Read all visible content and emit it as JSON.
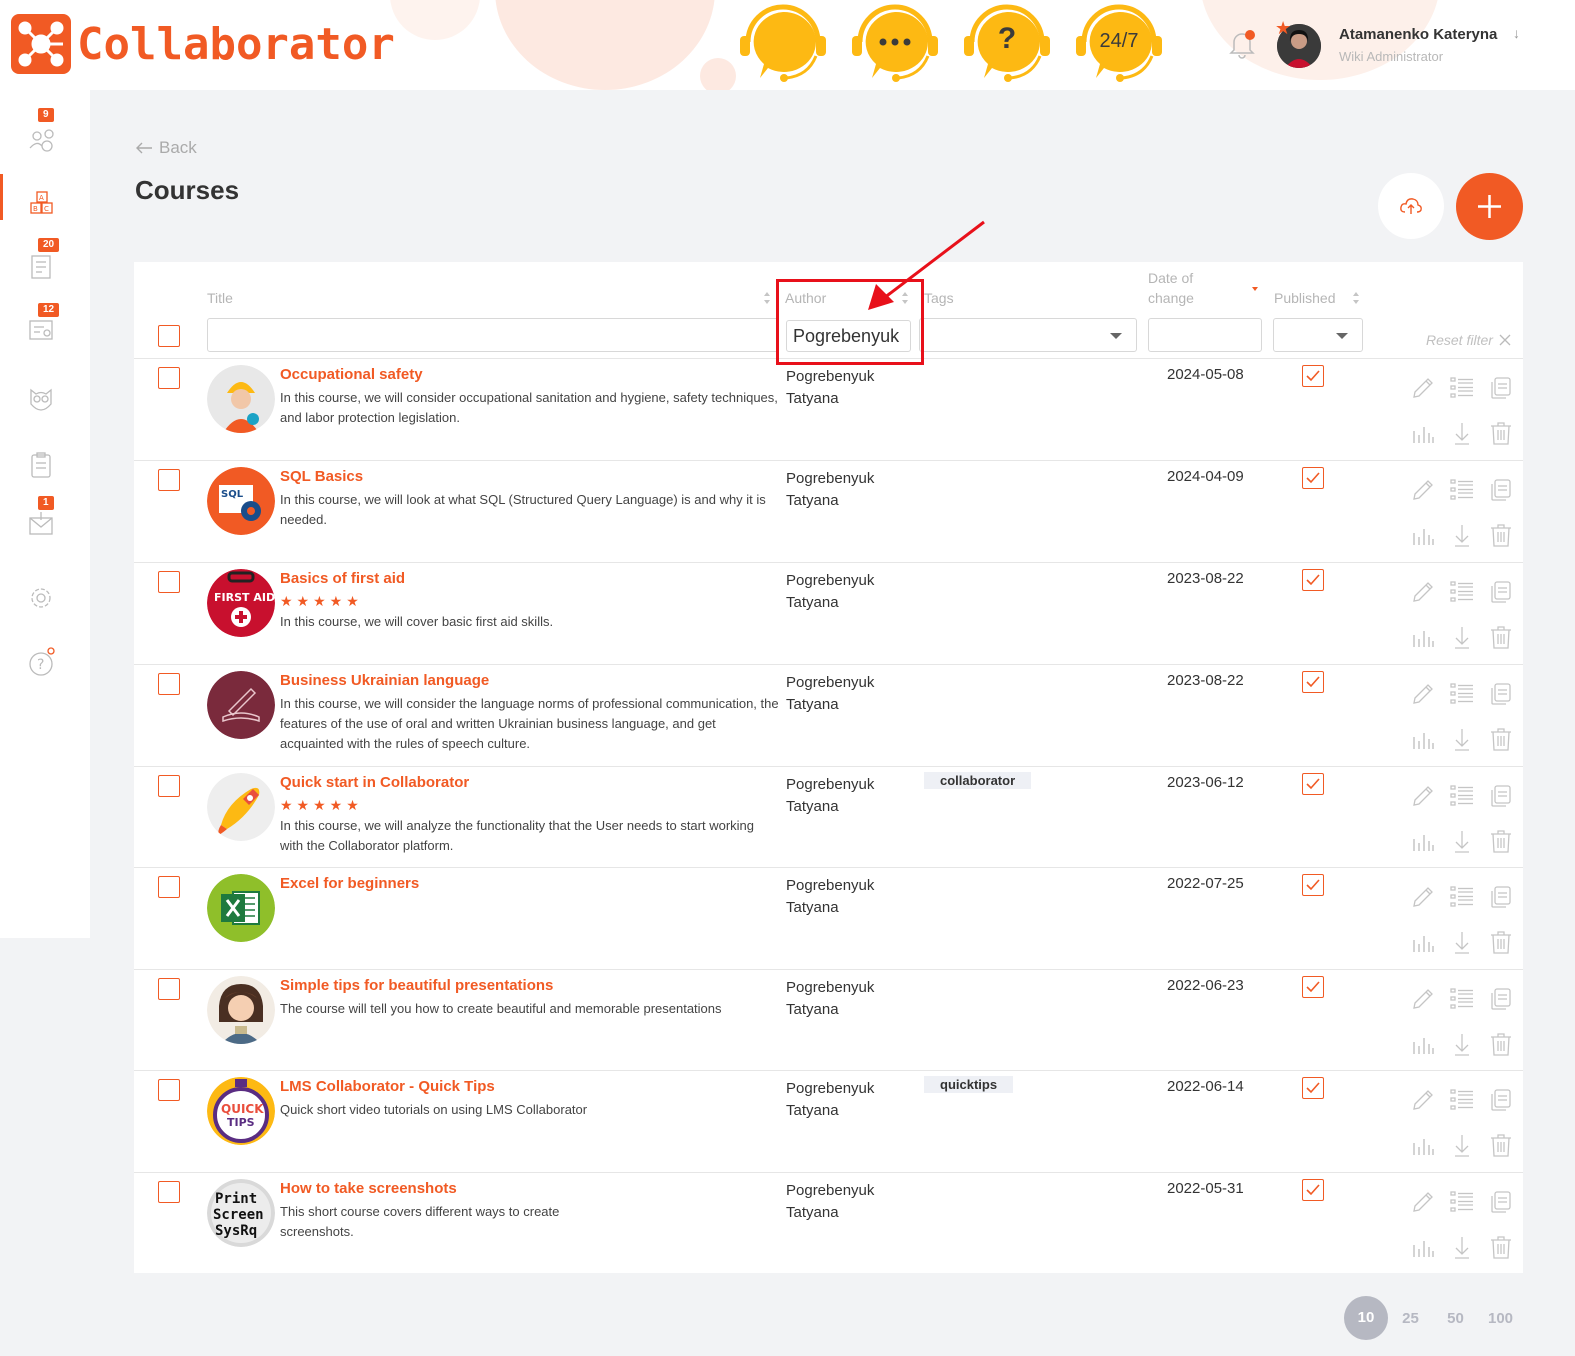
{
  "app": {
    "logo_text": "Collaborator"
  },
  "support": [
    {
      "icon": "headset-chat-icon",
      "label": ""
    },
    {
      "icon": "more-chat-icon",
      "label": ""
    },
    {
      "icon": "help-chat-icon",
      "label": "?"
    },
    {
      "icon": "support-24-7-icon",
      "label": "24/7"
    }
  ],
  "user": {
    "name": "Atamanenko Kateryna",
    "role": "Wiki Administrator"
  },
  "sidebar": {
    "items": [
      {
        "name": "users-icon",
        "badge": "9"
      },
      {
        "name": "courses-icon",
        "badge": ""
      },
      {
        "name": "tests-icon",
        "badge": "20"
      },
      {
        "name": "certificates-icon",
        "badge": "12"
      },
      {
        "name": "owl-icon",
        "badge": ""
      },
      {
        "name": "clipboard-icon",
        "badge": ""
      },
      {
        "name": "inbox-icon",
        "badge": "1"
      },
      {
        "name": "settings-icon",
        "badge": ""
      },
      {
        "name": "help-icon",
        "badge": ""
      }
    ]
  },
  "page": {
    "back_label": "Back",
    "title": "Courses"
  },
  "table": {
    "headers": {
      "title": "Title",
      "author": "Author",
      "tags": "Tags",
      "date_line1": "Date of",
      "date_line2": "change",
      "published": "Published"
    },
    "filters": {
      "title": "",
      "author": "Pogrebenyuk T",
      "tags": "",
      "date": "",
      "published": ""
    },
    "reset_filter": "Reset filter",
    "rows": [
      {
        "title": "Occupational safety",
        "stars": "",
        "description": "In this course, we will consider occupational sanitation and hygiene, safety techniques, and labor protection legislation.",
        "author_line1": "Pogrebenyuk",
        "author_line2": "Tatyana",
        "tag": "",
        "date": "2024-05-08",
        "published": true
      },
      {
        "title": "SQL Basics",
        "stars": "",
        "description": "In this course, we will look at what SQL (Structured Query Language) is and why it is needed.",
        "author_line1": "Pogrebenyuk",
        "author_line2": "Tatyana",
        "tag": "",
        "date": "2024-04-09",
        "published": true
      },
      {
        "title": "Basics of first aid",
        "stars": "★★★★★",
        "description": "In this course, we will cover basic first aid skills.",
        "author_line1": "Pogrebenyuk",
        "author_line2": "Tatyana",
        "tag": "",
        "date": "2023-08-22",
        "published": true
      },
      {
        "title": "Business Ukrainian language",
        "stars": "",
        "description": "In this course, we will consider the language norms of professional communication, the features of the use of oral and written Ukrainian business language, and get acquainted with the rules of speech culture.",
        "author_line1": "Pogrebenyuk",
        "author_line2": "Tatyana",
        "tag": "",
        "date": "2023-08-22",
        "published": true
      },
      {
        "title": "Quick start in Collaborator",
        "stars": "★★★★★",
        "description": "In this course, we will analyze the functionality that the User needs to start working with the Collaborator platform.",
        "author_line1": "Pogrebenyuk",
        "author_line2": "Tatyana",
        "tag": "collaborator",
        "date": "2023-06-12",
        "published": true
      },
      {
        "title": "Excel for beginners",
        "stars": "",
        "description": "",
        "author_line1": "Pogrebenyuk",
        "author_line2": "Tatyana",
        "tag": "",
        "date": "2022-07-25",
        "published": true
      },
      {
        "title": "Simple tips for beautiful presentations",
        "stars": "",
        "description": "The course will tell you how to create beautiful and memorable presentations",
        "author_line1": "Pogrebenyuk",
        "author_line2": "Tatyana",
        "tag": "",
        "date": "2022-06-23",
        "published": true
      },
      {
        "title": "LMS Collaborator - Quick Tips",
        "stars": "",
        "description": "Quick short video tutorials on using LMS Collaborator",
        "author_line1": "Pogrebenyuk",
        "author_line2": "Tatyana",
        "tag": "quicktips",
        "date": "2022-06-14",
        "published": true
      },
      {
        "title": "How to take screenshots",
        "stars": "",
        "description": "This short course covers different ways to create screenshots.",
        "author_line1": "Pogrebenyuk",
        "author_line2": "Tatyana",
        "tag": "",
        "date": "2022-05-31",
        "published": true
      }
    ],
    "thumb_labels": {
      "sql": "SQL",
      "first_aid": "FIRST AID",
      "quick": "QUICK",
      "tips": "TIPS",
      "print": "Print",
      "screen": "Screen",
      "sysrq": "SysRq"
    }
  },
  "pagination": {
    "options": [
      "10",
      "25",
      "50",
      "100"
    ],
    "active": "10"
  },
  "colors": {
    "accent": "#f15a24",
    "highlight": "#e8101a",
    "support_yellow": "#fdb913"
  }
}
